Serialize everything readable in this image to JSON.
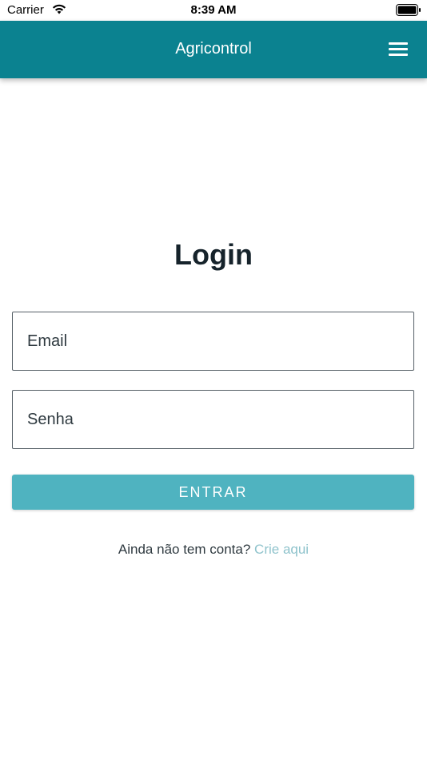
{
  "status_bar": {
    "carrier": "Carrier",
    "time": "8:39 AM",
    "wifi_icon": "wifi-icon",
    "battery_icon": "battery-icon"
  },
  "app_bar": {
    "title": "Agricontrol",
    "menu_icon": "hamburger-menu-icon",
    "background_color": "#0b8290"
  },
  "login": {
    "title": "Login",
    "email_placeholder": "Email",
    "email_value": "",
    "password_placeholder": "Senha",
    "password_value": "",
    "submit_label": "ENTRAR",
    "submit_color": "#4fb3c0",
    "signup_prompt": "Ainda não tem conta?",
    "signup_link": "Crie aqui",
    "link_color": "#8fc3cc"
  }
}
